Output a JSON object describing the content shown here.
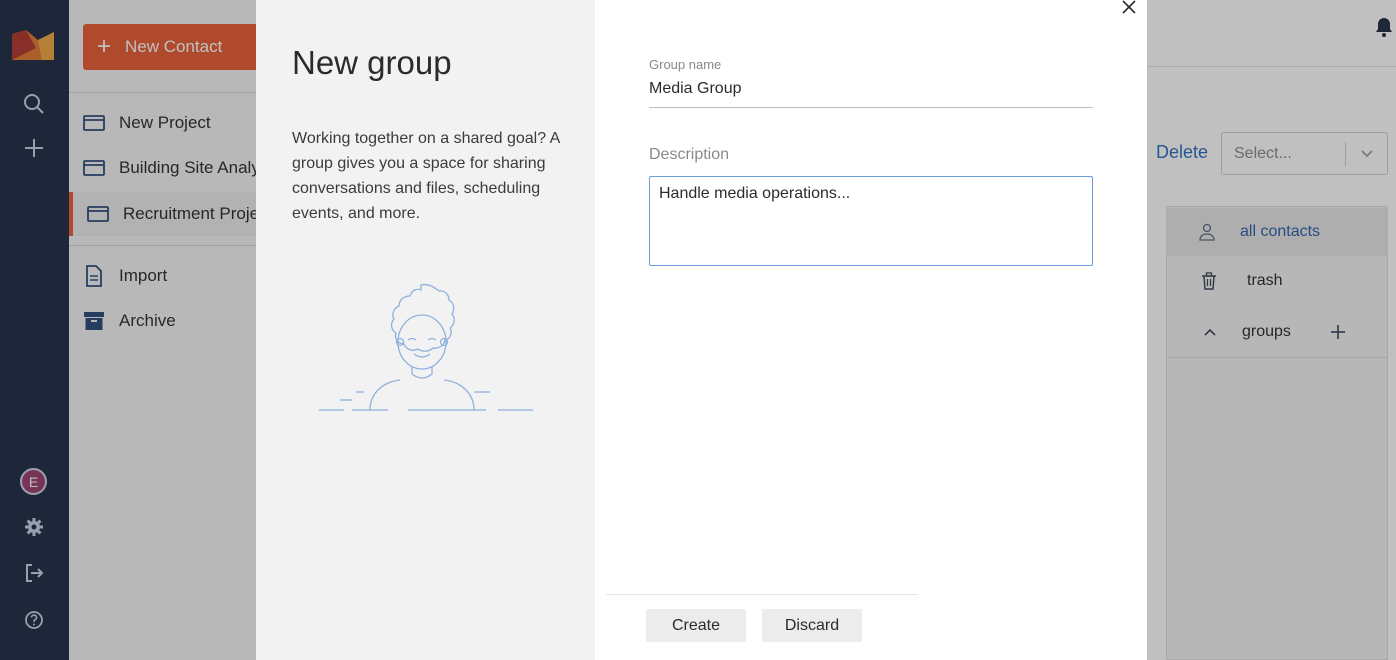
{
  "rail": {
    "avatar_letter": "E",
    "icons": [
      "brand-logo",
      "search-icon",
      "plus-icon",
      "gear-icon",
      "logout-icon",
      "help-icon"
    ]
  },
  "sidebar": {
    "new_contact_label": "New Contact",
    "items": [
      {
        "label": "New Project",
        "icon": "card-icon"
      },
      {
        "label": "Building Site Analysis",
        "icon": "card-icon"
      },
      {
        "label": "Recruitment Project",
        "icon": "card-icon",
        "active": true
      },
      {
        "label": "Import",
        "icon": "document-icon"
      },
      {
        "label": "Archive",
        "icon": "archive-icon"
      }
    ]
  },
  "right": {
    "delete_label": "Delete",
    "select_placeholder": "Select...",
    "panel": [
      {
        "label": "all contacts",
        "icon": "person-icon"
      },
      {
        "label": "trash",
        "icon": "trash-icon"
      },
      {
        "label": "groups",
        "icon": "chevron-up-icon"
      }
    ]
  },
  "modal": {
    "title": "New group",
    "description": "Working together on a shared goal? A group gives you a space for sharing conversations and files, scheduling events, and more.",
    "group_name_label": "Group name",
    "group_name_value": "Media Group",
    "description_label": "Description",
    "description_value": "Handle media operations...",
    "create_label": "Create",
    "discard_label": "Discard"
  },
  "colors": {
    "rail_bg": "#1f2a44",
    "accent_orange": "#e85d33",
    "link_blue": "#2a6fbd"
  }
}
